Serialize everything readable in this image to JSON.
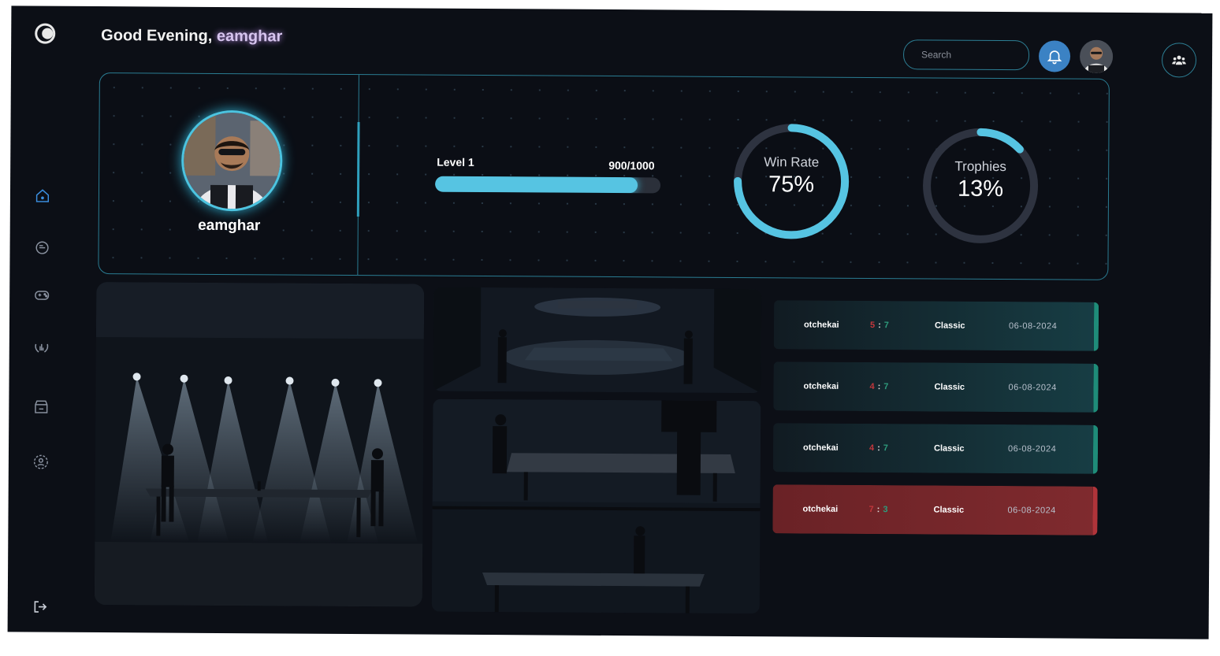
{
  "header": {
    "greeting_prefix": "Good Evening,",
    "username": "eamghar",
    "search_placeholder": "Search"
  },
  "sidebar": {
    "items": [
      {
        "name": "home-icon",
        "active": true
      },
      {
        "name": "chat-icon",
        "active": false
      },
      {
        "name": "game-controller-icon",
        "active": false
      },
      {
        "name": "leaderboard-icon",
        "active": false
      },
      {
        "name": "store-icon",
        "active": false
      },
      {
        "name": "profile-icon",
        "active": false
      }
    ],
    "bottom": {
      "name": "logout-icon"
    }
  },
  "profile": {
    "name": "eamghar"
  },
  "level": {
    "label": "Level 1",
    "xp_text": "900/1000",
    "progress": 0.9
  },
  "stats": {
    "win_rate": {
      "label": "Win Rate",
      "value": "75%",
      "fraction": 0.75
    },
    "trophies": {
      "label": "Trophies",
      "value": "13%",
      "fraction": 0.13
    }
  },
  "matches": [
    {
      "opponent": "otchekai",
      "score_a": "5",
      "score_b": "7",
      "mode": "Classic",
      "date": "06-08-2024",
      "result": "win"
    },
    {
      "opponent": "otchekai",
      "score_a": "4",
      "score_b": "7",
      "mode": "Classic",
      "date": "06-08-2024",
      "result": "win"
    },
    {
      "opponent": "otchekai",
      "score_a": "4",
      "score_b": "7",
      "mode": "Classic",
      "date": "06-08-2024",
      "result": "win"
    },
    {
      "opponent": "otchekai",
      "score_a": "7",
      "score_b": "3",
      "mode": "Classic",
      "date": "06-08-2024",
      "result": "loss"
    }
  ],
  "colors": {
    "accent": "#56c4e2",
    "bell": "#3b82c4",
    "win": "#1f8c79",
    "loss": "#b0343a"
  }
}
